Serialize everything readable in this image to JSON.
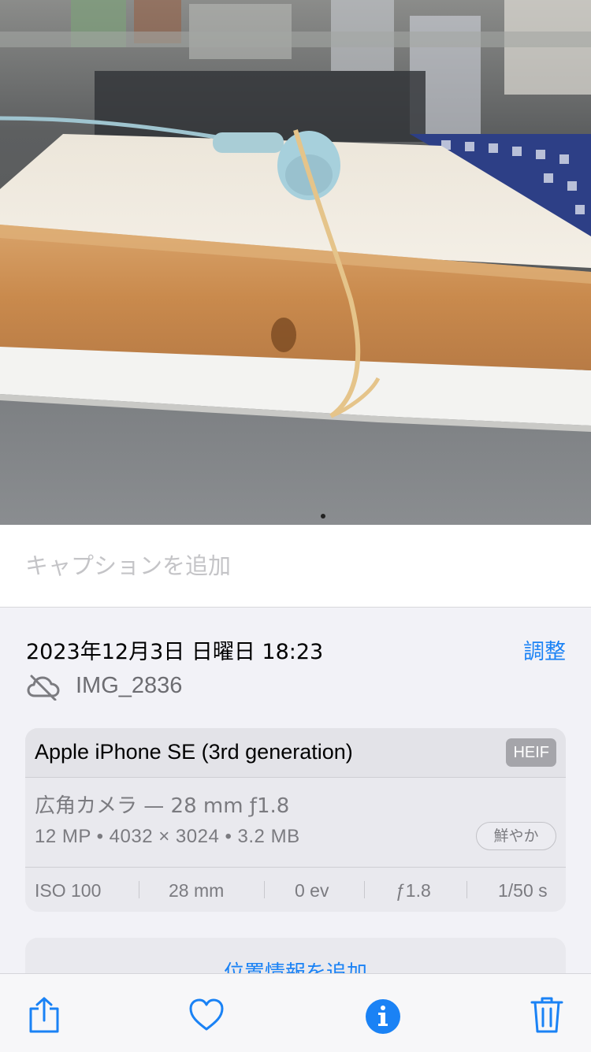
{
  "photo": {
    "subject": "bread"
  },
  "caption": {
    "placeholder": "キャプションを追加",
    "value": ""
  },
  "info": {
    "date": "2023年12月3日 日曜日 18:23",
    "adjust_label": "調整",
    "filename": "IMG_2836",
    "cloud_icon": "icloud-slash-icon"
  },
  "metadata": {
    "device": "Apple iPhone SE (3rd generation)",
    "format_badge": "HEIF",
    "lens": "広角カメラ — 28 mm ƒ1.8",
    "specs": "12 MP • 4032 × 3024 • 3.2 MB",
    "style_badge": "鮮やか",
    "exif": [
      "ISO 100",
      "28 mm",
      "0 ev",
      "ƒ1.8",
      "1/50 s"
    ]
  },
  "location": {
    "label": "位置情報を追加"
  },
  "toolbar": {
    "items": [
      "share-icon",
      "heart-icon",
      "info-icon",
      "trash-icon"
    ]
  },
  "colors": {
    "accent": "#1a82f5",
    "secondary_text": "#7b7b80",
    "background": "#f2f2f7"
  }
}
